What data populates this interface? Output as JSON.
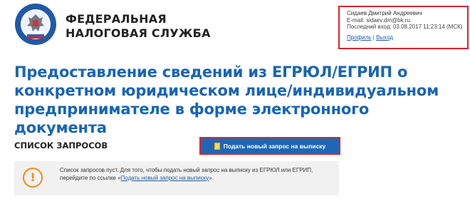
{
  "header": {
    "org_line1": "ФЕДЕРАЛЬНАЯ",
    "org_line2": "НАЛОГОВАЯ СЛУЖБА",
    "logo_text": "ФЕДЕРАЛЬНАЯ НАЛОГОВАЯ СЛУЖБА"
  },
  "user": {
    "name": "Сидаев Дмитрий Андреевич",
    "email_label": "E-mail:",
    "email": "sidaev.dm@bk.ru",
    "last_login_label": "Последний вход:",
    "last_login": "03.08.2017 11:23:14 (МСК)",
    "profile_link": "Профиль",
    "separator": "|",
    "logout_link": "Выход"
  },
  "page": {
    "title": "Предоставление сведений из ЕГРЮЛ/ЕГРИП о конкретном юридическом лице/индивидуальном предпринимателе в форме электронного документа"
  },
  "requests": {
    "heading": "СПИСОК ЗАПРОСОВ",
    "new_button": "Подать новый запрос на выписку",
    "notice_icon": "!",
    "notice_text": "Список запросов пуст. Для того, чтобы подать новый запрос на выписку из ЕГРЮЛ или ЕГРИП, перейдите по ссылке «",
    "notice_link": "Подать новый запрос на выписку",
    "notice_end": "»."
  },
  "colors": {
    "title": "#1964b3",
    "accent_red": "#d9262b",
    "button_blue": "#1f67b6",
    "warning": "#f28a1b"
  }
}
